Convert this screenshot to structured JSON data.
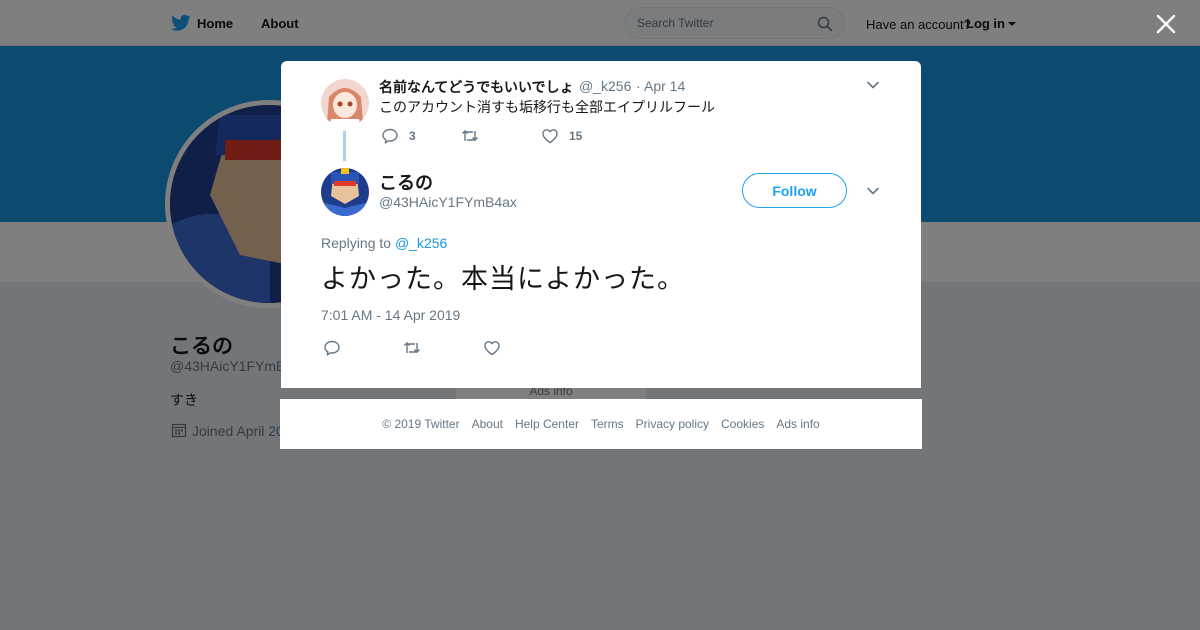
{
  "topbar": {
    "home_label": "Home",
    "about_label": "About",
    "search_placeholder": "Search Twitter",
    "have_account": "Have an account?",
    "login_label": "Log in"
  },
  "profile": {
    "name": "こるの",
    "handle": "@43HAicY1FYmB",
    "bio": "すき",
    "joined": "Joined April 20",
    "ads_info": "Ads info"
  },
  "parent_tweet": {
    "name": "名前なんてどうでもいいでしょ",
    "handle": "@_k256",
    "dot": "·",
    "date": "Apr 14",
    "text": "このアカウント消すも垢移行も全部エイプリルフール",
    "reply_count": "3",
    "like_count": "15"
  },
  "main_tweet": {
    "name": "こるの",
    "handle": "@43HAicY1FYmB4ax",
    "follow_label": "Follow",
    "replying_prefix": "Replying to",
    "replying_to": "@_k256",
    "text": "よかった。本当によかった。",
    "timestamp": "7:01 AM - 14 Apr 2019"
  },
  "footer": {
    "copyright": "© 2019 Twitter",
    "links": [
      "About",
      "Help Center",
      "Terms",
      "Privacy policy",
      "Cookies",
      "Ads info"
    ]
  },
  "colors": {
    "brand_blue": "#1da1f2",
    "banner_blue": "#1b95e0",
    "text_primary": "#14171a",
    "text_secondary": "#657786",
    "thread_line": "#a3d3f5"
  },
  "icons": [
    "twitter-bird-icon",
    "search-icon",
    "caret-down-icon",
    "close-icon",
    "chevron-down-icon",
    "reply-icon",
    "retweet-icon",
    "like-icon",
    "calendar-icon"
  ]
}
